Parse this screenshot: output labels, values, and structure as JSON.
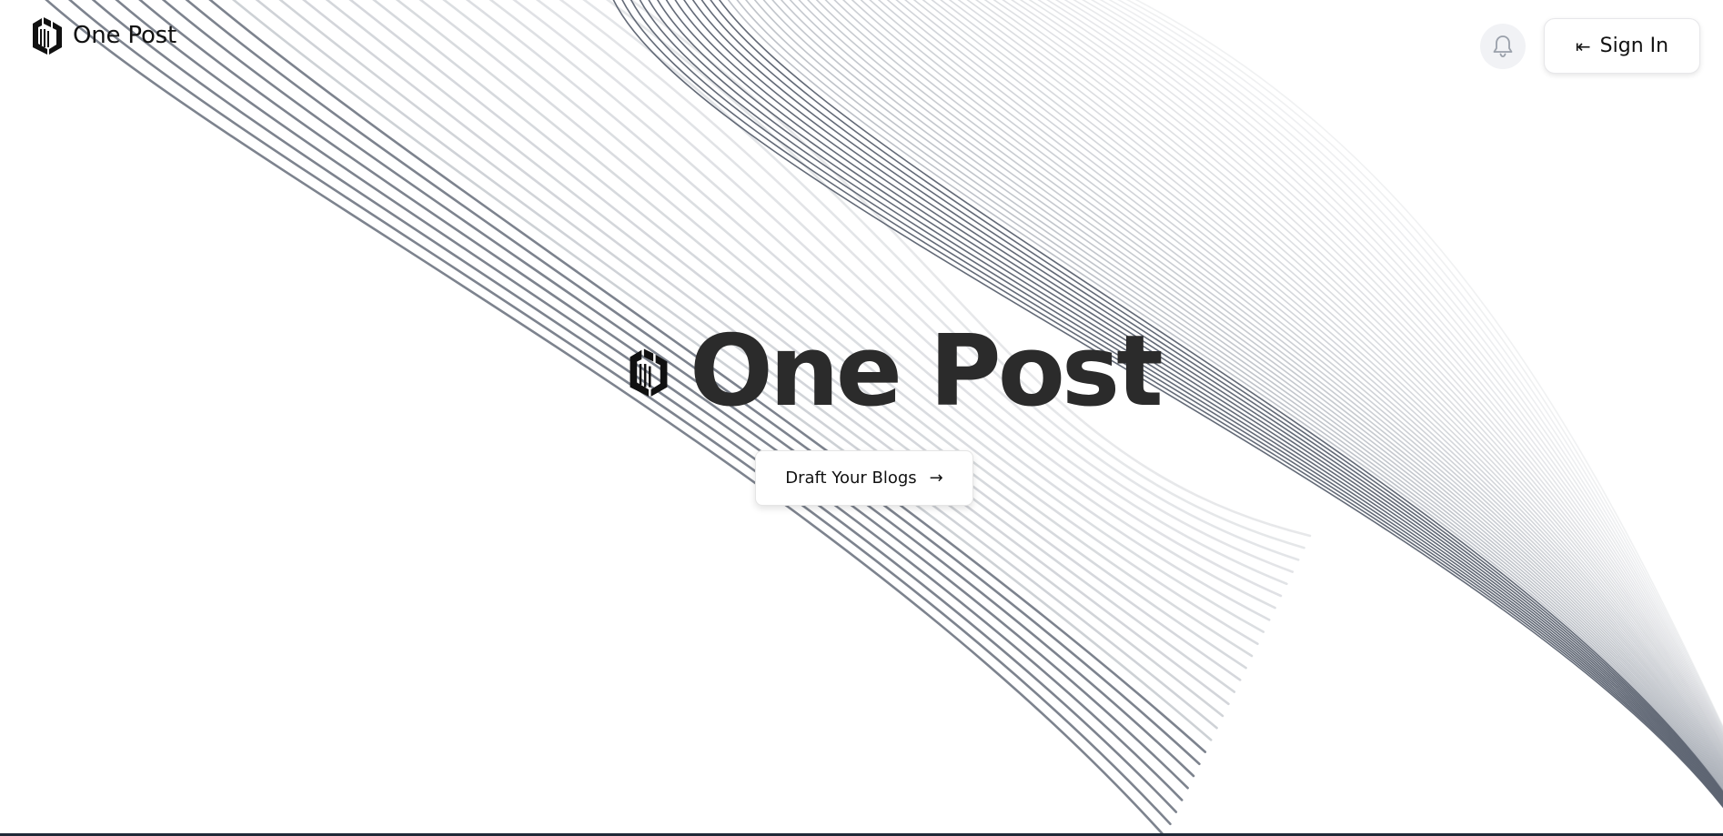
{
  "header": {
    "brand": "One Post",
    "signin_label": "Sign In",
    "signin_icon": "login-arrow-icon",
    "notification_icon": "bell-icon"
  },
  "hero": {
    "title": "One Post",
    "cta_label": "Draft Your Blogs",
    "cta_icon": "→"
  },
  "colors": {
    "text": "#111111",
    "title": "#2b2b2b",
    "line_dark": "#5b6270",
    "line_light": "#c7cbd2",
    "bell_bg": "#f1f2f5"
  }
}
